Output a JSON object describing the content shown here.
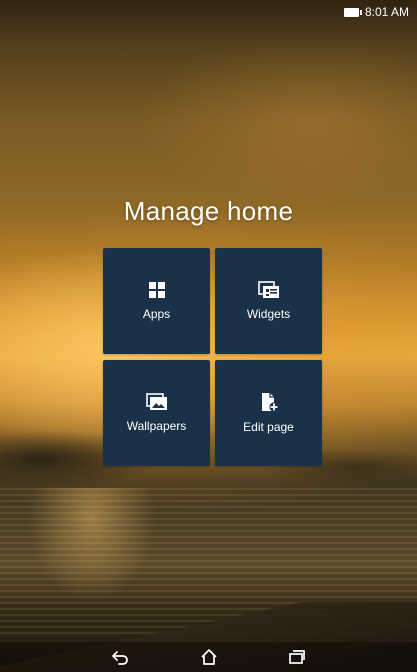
{
  "status_bar": {
    "time": "8:01 AM",
    "battery_icon": "battery-icon"
  },
  "title": "Manage home",
  "tiles": [
    {
      "label": "Apps",
      "icon": "apps-grid-icon"
    },
    {
      "label": "Widgets",
      "icon": "widgets-icon"
    },
    {
      "label": "Wallpapers",
      "icon": "wallpapers-icon"
    },
    {
      "label": "Edit page",
      "icon": "edit-page-icon"
    }
  ],
  "nav_bar": {
    "back_icon": "back-icon",
    "home_icon": "home-icon",
    "recents_icon": "recent-apps-icon"
  },
  "colors": {
    "tile_background": "#1b3148",
    "text": "#ffffff"
  }
}
